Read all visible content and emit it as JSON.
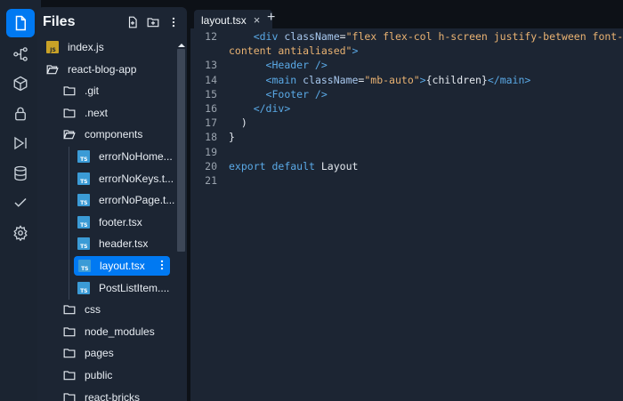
{
  "sidebar": {
    "title": "Files",
    "items": [
      {
        "label": "index.js",
        "icon": "js-file-icon",
        "depth": 0
      },
      {
        "label": "react-blog-app",
        "icon": "folder-open-icon",
        "depth": 0
      },
      {
        "label": ".git",
        "icon": "folder-icon",
        "depth": 1
      },
      {
        "label": ".next",
        "icon": "folder-icon",
        "depth": 1
      },
      {
        "label": "components",
        "icon": "folder-open-icon",
        "depth": 1
      },
      {
        "label": "errorNoHome...",
        "icon": "ts-file-icon",
        "depth": 2
      },
      {
        "label": "errorNoKeys.t...",
        "icon": "ts-file-icon",
        "depth": 2
      },
      {
        "label": "errorNoPage.t...",
        "icon": "ts-file-icon",
        "depth": 2
      },
      {
        "label": "footer.tsx",
        "icon": "ts-file-icon",
        "depth": 2
      },
      {
        "label": "header.tsx",
        "icon": "ts-file-icon",
        "depth": 2
      },
      {
        "label": "layout.tsx",
        "icon": "ts-file-icon",
        "depth": 2,
        "selected": true
      },
      {
        "label": "PostListItem....",
        "icon": "ts-file-icon",
        "depth": 2
      },
      {
        "label": "css",
        "icon": "folder-icon",
        "depth": 1
      },
      {
        "label": "node_modules",
        "icon": "folder-icon",
        "depth": 1
      },
      {
        "label": "pages",
        "icon": "folder-icon",
        "depth": 1
      },
      {
        "label": "public",
        "icon": "folder-icon",
        "depth": 1
      },
      {
        "label": "react-bricks",
        "icon": "folder-icon",
        "depth": 1
      }
    ]
  },
  "editor": {
    "tab_label": "layout.tsx",
    "tab_close": "×",
    "new_tab": "+",
    "lines": [
      {
        "num": "12",
        "tokens": [
          [
            "plain",
            "    "
          ],
          [
            "tag",
            "<div"
          ],
          [
            "plain",
            " "
          ],
          [
            "attr",
            "className"
          ],
          [
            "plain",
            "="
          ],
          [
            "str",
            "\"flex flex-col h-screen justify-between font-"
          ]
        ]
      },
      {
        "num": "",
        "tokens": [
          [
            "str",
            "content antialiased\""
          ],
          [
            "tag",
            ">"
          ]
        ]
      },
      {
        "num": "13",
        "tokens": [
          [
            "plain",
            "      "
          ],
          [
            "tag",
            "<Header />"
          ]
        ]
      },
      {
        "num": "14",
        "tokens": [
          [
            "plain",
            "      "
          ],
          [
            "tag",
            "<main"
          ],
          [
            "plain",
            " "
          ],
          [
            "attr",
            "className"
          ],
          [
            "plain",
            "="
          ],
          [
            "str",
            "\"mb-auto\""
          ],
          [
            "tag",
            ">"
          ],
          [
            "plain",
            "{children}"
          ],
          [
            "tag",
            "</main>"
          ]
        ]
      },
      {
        "num": "15",
        "tokens": [
          [
            "plain",
            "      "
          ],
          [
            "tag",
            "<Footer />"
          ]
        ]
      },
      {
        "num": "16",
        "tokens": [
          [
            "plain",
            "    "
          ],
          [
            "tag",
            "</div>"
          ]
        ]
      },
      {
        "num": "17",
        "tokens": [
          [
            "plain",
            "  )"
          ]
        ]
      },
      {
        "num": "18",
        "tokens": [
          [
            "plain",
            "}"
          ]
        ]
      },
      {
        "num": "19",
        "tokens": []
      },
      {
        "num": "20",
        "tokens": [
          [
            "kw",
            "export"
          ],
          [
            "plain",
            " "
          ],
          [
            "kw",
            "default"
          ],
          [
            "plain",
            " Layout"
          ]
        ]
      },
      {
        "num": "21",
        "tokens": []
      }
    ]
  },
  "colors": {
    "accent": "#0079f2",
    "ts_icon": "#3b9bd6",
    "js_icon": "#c9a227"
  }
}
